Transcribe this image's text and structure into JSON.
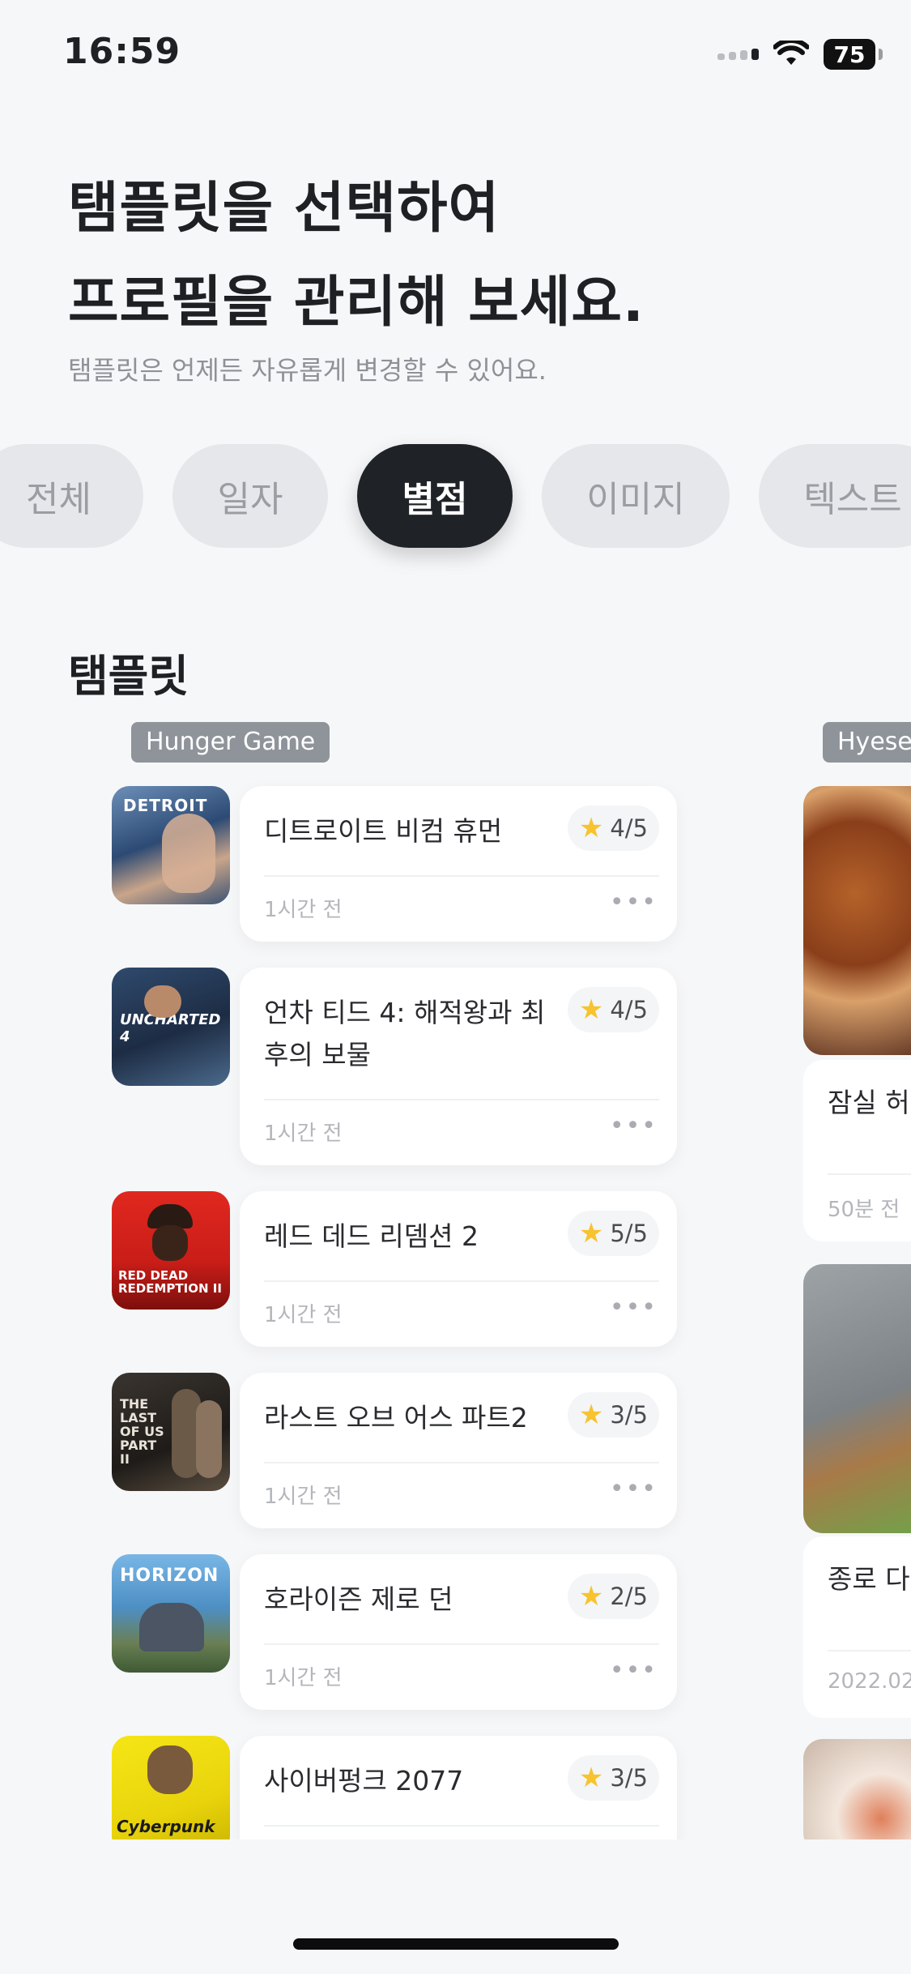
{
  "status_bar": {
    "time": "16:59",
    "battery": "75"
  },
  "header": {
    "title_line1": "탬플릿을 선택하여",
    "title_line2": "프로필을 관리해 보세요.",
    "subtitle": "탬플릿은 언제든 자유롭게 변경할 수 있어요."
  },
  "filters": {
    "items": [
      "전체",
      "일자",
      "별점",
      "이미지",
      "텍스트"
    ],
    "selected": "별점"
  },
  "section_title": "탬플릿",
  "templates": [
    {
      "tag": "Hunger Game",
      "items": [
        {
          "title": "디트로이트 비컴 휴먼",
          "rating": "4/5",
          "time": "1시간 전",
          "thumb_label": "DETROIT"
        },
        {
          "title": "언차 티드 4: 해적왕과 최후의 보물",
          "rating": "4/5",
          "time": "1시간 전",
          "thumb_label": "UNCHARTED 4"
        },
        {
          "title": "레드 데드 리뎀션 2",
          "rating": "5/5",
          "time": "1시간 전",
          "thumb_label": "RED DEAD REDEMPTION II"
        },
        {
          "title": "라스트 오브 어스 파트2",
          "rating": "3/5",
          "time": "1시간 전",
          "thumb_label": "THE LAST OF US PART II"
        },
        {
          "title": "호라이즌 제로 던",
          "rating": "2/5",
          "time": "1시간 전",
          "thumb_label": "HORIZON"
        },
        {
          "title": "사이버펑크 2077",
          "rating": "3/5",
          "time": "",
          "thumb_label": "Cyberpunk"
        }
      ]
    },
    {
      "tag": "Hyesec",
      "items": [
        {
          "title": "잠실 허",
          "time": "50분 전"
        },
        {
          "title": "종로 다",
          "time": "2022.02"
        }
      ]
    }
  ],
  "colors": {
    "accent_dark": "#1f2226",
    "star": "#f7c32e",
    "chip_bg": "#e6e7ea"
  },
  "icons": {
    "star": "star-icon",
    "more": "more-dots-icon",
    "wifi": "wifi-icon",
    "signal": "signal-icon",
    "battery": "battery-icon"
  }
}
